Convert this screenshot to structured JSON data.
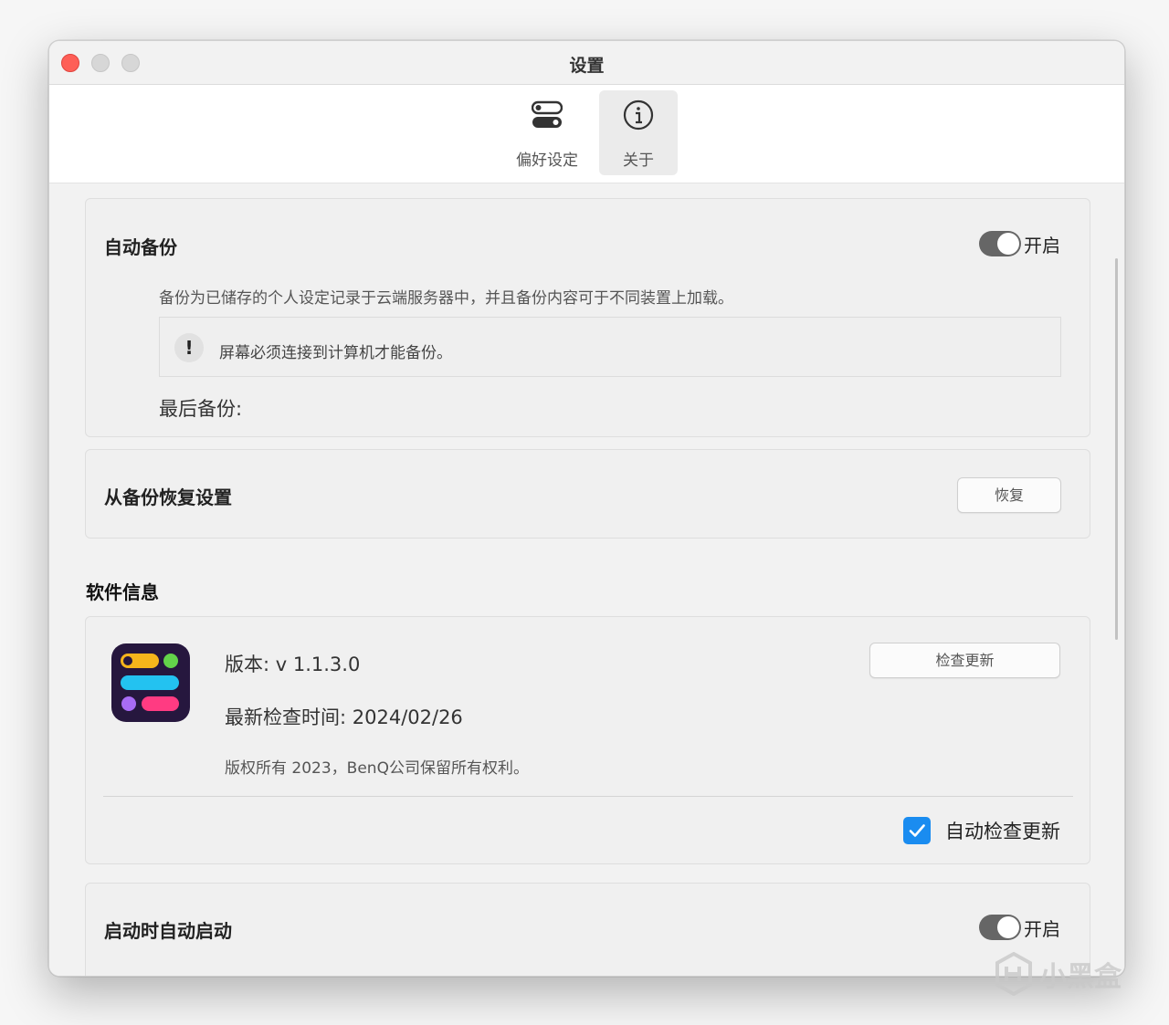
{
  "window": {
    "title": "设置"
  },
  "tabs": [
    {
      "label": "偏好设定",
      "icon": "toggles-icon",
      "selected": false
    },
    {
      "label": "关于",
      "icon": "info-icon",
      "selected": true
    }
  ],
  "auto_backup": {
    "title": "自动备份",
    "toggle_state": "开启",
    "description": "备份为已储存的个人设定记录于云端服务器中，并且备份内容可于不同装置上加载。",
    "warning": "屏幕必须连接到计算机才能备份。",
    "warning_icon": "!",
    "last_backup_label": "最后备份:"
  },
  "restore": {
    "title": "从备份恢复设置",
    "button_label": "恢复"
  },
  "software_info": {
    "section_title": "软件信息",
    "version": "版本: v 1.1.3.0",
    "last_check": "最新检查时间: 2024/02/26",
    "copyright": "版权所有 2023，BenQ公司保留所有权利。",
    "check_update_button": "检查更新",
    "auto_check_label": "自动检查更新",
    "auto_check_checked": true
  },
  "launch_at_startup": {
    "title": "启动时自动启动",
    "toggle_state": "开启"
  },
  "watermark": {
    "text": "小黑盒"
  },
  "colors": {
    "close": "#fe5f57",
    "accent": "#1a8cf0",
    "toggle_on": "#666666"
  }
}
